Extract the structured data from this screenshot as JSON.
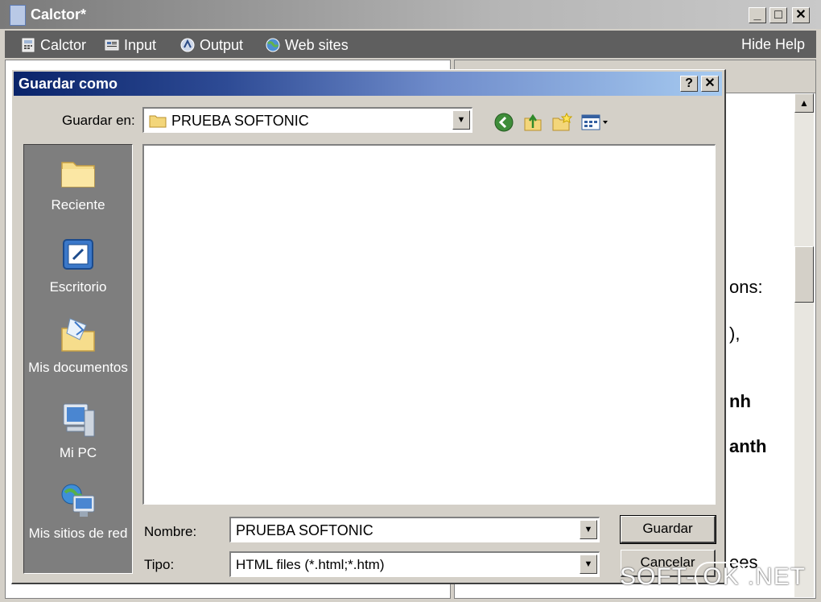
{
  "app": {
    "title": "Calctor*",
    "window_buttons": [
      "_",
      "□",
      "✕"
    ],
    "menu": [
      {
        "label": "Calctor",
        "icon": "calculator-icon"
      },
      {
        "label": "Input",
        "icon": "keyboard-icon"
      },
      {
        "label": "Output",
        "icon": "output-icon"
      },
      {
        "label": "Web sites",
        "icon": "globe-icon"
      }
    ],
    "hide_help_label": "Hide Help",
    "help_fragments": [
      "ons:",
      "),",
      "nh",
      "anth",
      "ees"
    ]
  },
  "dialog": {
    "title": "Guardar como",
    "help_button": "?",
    "close_button": "✕",
    "save_in_label": "Guardar en:",
    "save_in_value": "PRUEBA SOFTONIC",
    "places": [
      {
        "label": "Reciente",
        "icon": "recent-folder-icon"
      },
      {
        "label": "Escritorio",
        "icon": "desktop-icon"
      },
      {
        "label": "Mis documentos",
        "icon": "my-documents-icon"
      },
      {
        "label": "Mi PC",
        "icon": "my-computer-icon"
      },
      {
        "label": "Mis sitios de red",
        "icon": "network-places-icon"
      }
    ],
    "filename_label": "Nombre:",
    "filename_value": "PRUEBA SOFTONIC",
    "filetype_label": "Tipo:",
    "filetype_value": "HTML files (*.html;*.htm)",
    "save_button": "Guardar",
    "cancel_button": "Cancelar"
  },
  "watermark": {
    "text_left": "SOFT-",
    "text_ok": "OK",
    "text_right": ".NET"
  },
  "colors": {
    "dialog_title_start": "#0a246a",
    "dialog_title_end": "#a6caf0",
    "places_bar": "#7e7e7e",
    "menubar": "#5f5f5f"
  }
}
